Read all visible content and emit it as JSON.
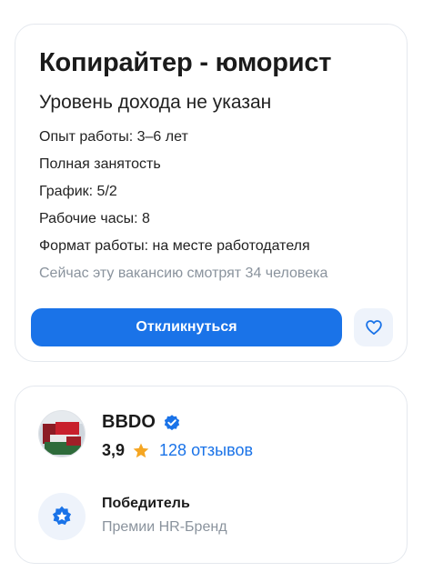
{
  "vacancy": {
    "title": "Копирайтер - юморист",
    "salary": "Уровень дохода не указан",
    "experience": "Опыт работы: 3–6 лет",
    "employment": "Полная занятость",
    "schedule": "График: 5/2",
    "hours": "Рабочие часы: 8",
    "work_format": "Формат работы: на месте работодателя",
    "viewers": "Сейчас эту вакансию смотрят 34 человека",
    "respond_label": "Откликнуться",
    "favorite_icon": "heart-icon"
  },
  "employer": {
    "name": "BBDO",
    "verified_icon": "verified-badge-icon",
    "rating": "3,9",
    "star_icon": "star-icon",
    "reviews": "128 отзывов",
    "award_title": "Победитель",
    "award_subtitle": "Премии HR-Бренд",
    "award_icon": "star-badge-icon"
  },
  "colors": {
    "accent": "#1a73e8",
    "star": "#f5a623",
    "muted_text": "#8a939d",
    "icon_bg": "#eef3fb"
  }
}
